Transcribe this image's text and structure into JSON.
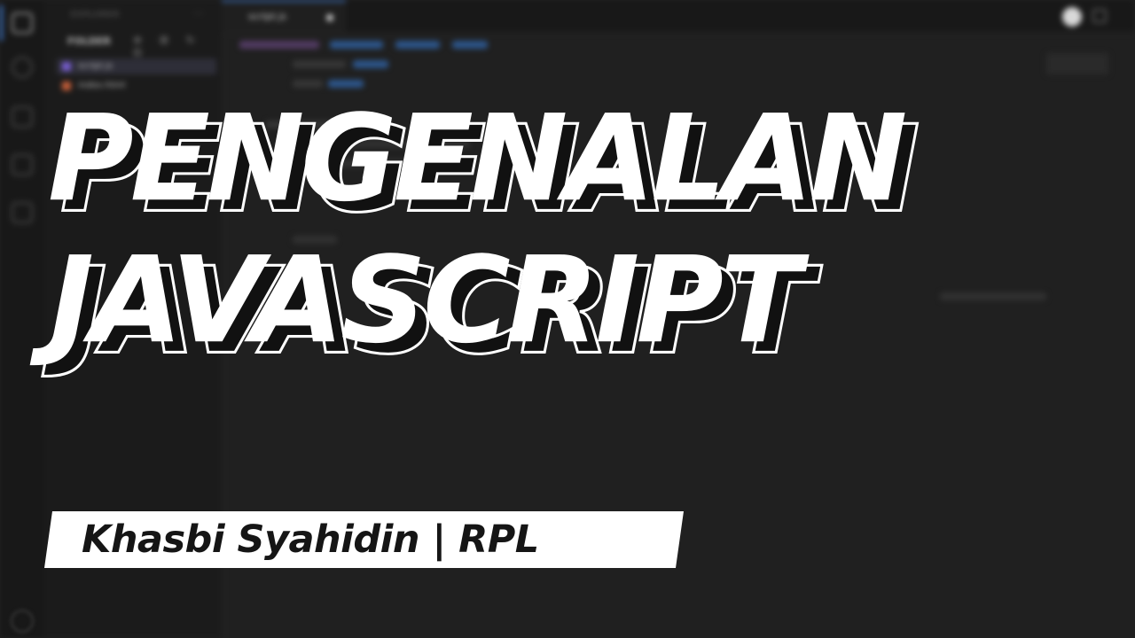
{
  "editor": {
    "explorer_title": "EXPLORER",
    "explorer_menu": "···",
    "folder_name": "FOLDER",
    "folder_tools": "⊕ ⊞ ↻ ⊟",
    "files": [
      {
        "name": "script.js",
        "color": "#7a5fd6"
      },
      {
        "name": "index.html",
        "color": "#c9603a"
      }
    ],
    "tab_label": "script.js",
    "accent": "#3d7bd6",
    "activity_icons": [
      "files-icon",
      "search-icon",
      "run-debug-icon",
      "source-control-icon",
      "extensions-icon"
    ]
  },
  "title": {
    "line1": "PENGENALAN",
    "line2": "JAVASCRIPT"
  },
  "author": {
    "text": "Khasbi Syahidin | RPL"
  },
  "colors": {
    "background": "#1e1e1e",
    "title_fill": "#ffffff",
    "title_shadow": "#111111",
    "banner": "#ffffff",
    "banner_text": "#151515"
  }
}
